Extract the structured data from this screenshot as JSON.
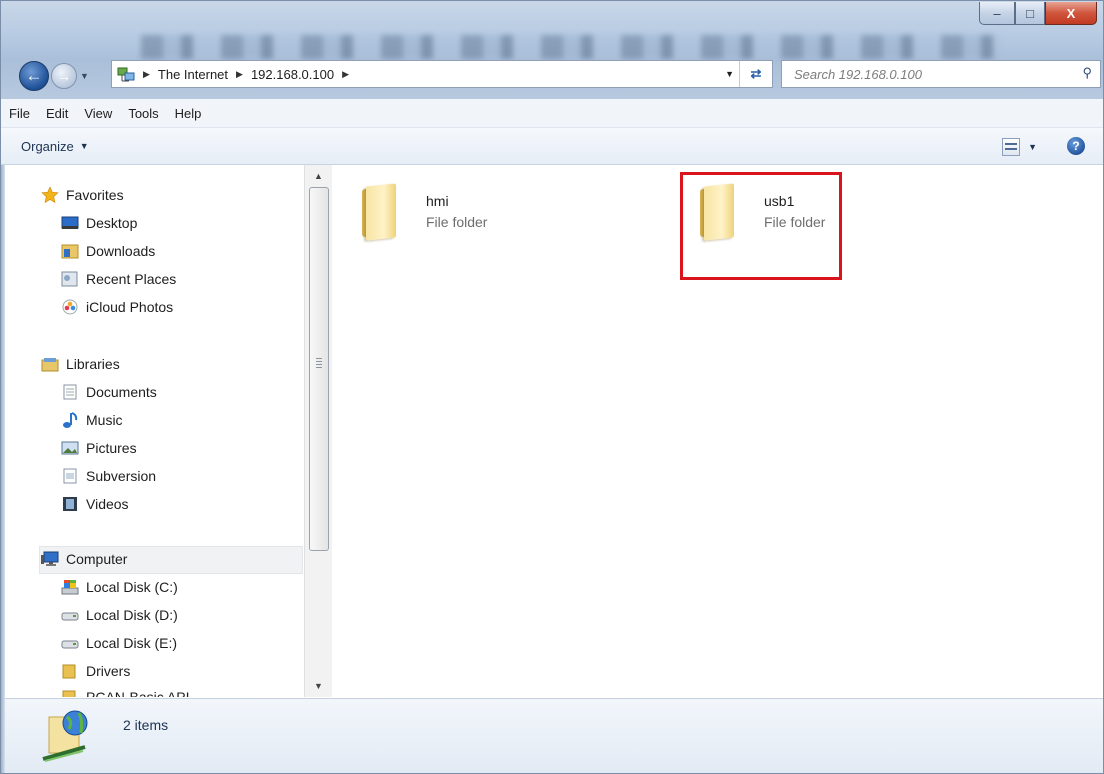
{
  "window": {
    "caption_min": "–",
    "caption_max": "□",
    "caption_close": "X"
  },
  "address": {
    "segments": [
      "The Internet",
      "192.168.0.100"
    ]
  },
  "search": {
    "placeholder": "Search 192.168.0.100"
  },
  "menu": [
    "File",
    "Edit",
    "View",
    "Tools",
    "Help"
  ],
  "command_bar": {
    "organize": "Organize",
    "help": "?"
  },
  "nav_pane": {
    "favorites": {
      "label": "Favorites",
      "items": [
        "Desktop",
        "Downloads",
        "Recent Places",
        "iCloud Photos"
      ]
    },
    "libraries": {
      "label": "Libraries",
      "items": [
        "Documents",
        "Music",
        "Pictures",
        "Subversion",
        "Videos"
      ]
    },
    "computer": {
      "label": "Computer",
      "items": [
        "Local Disk (C:)",
        "Local Disk (D:)",
        "Local Disk (E:)",
        "Drivers",
        "PCAN-Basic API"
      ]
    }
  },
  "content": {
    "items": [
      {
        "name": "hmi",
        "type": "File folder"
      },
      {
        "name": "usb1",
        "type": "File folder"
      }
    ]
  },
  "details": {
    "count": "2 items"
  },
  "colors": {
    "highlight": "#d9141a",
    "accent": "#1f4f9a"
  }
}
